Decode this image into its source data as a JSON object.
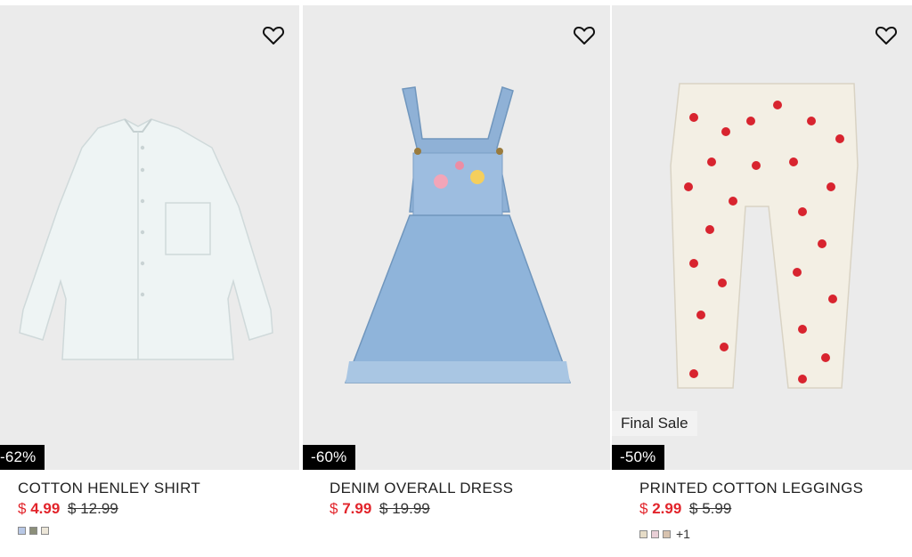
{
  "products": [
    {
      "name": "COTTON HENLEY SHIRT",
      "currency": "$",
      "sale_price": "4.99",
      "original_price": "$ 12.99",
      "discount": "-62%",
      "swatch_colors": [
        "#b8c8e6",
        "#8c8f7a",
        "#ece6d8"
      ],
      "more_colors": ""
    },
    {
      "name": "DENIM OVERALL DRESS",
      "currency": "$",
      "sale_price": "7.99",
      "original_price": "$ 19.99",
      "discount": "-60%",
      "swatch_colors": [],
      "more_colors": ""
    },
    {
      "name": "PRINTED COTTON LEGGINGS",
      "currency": "$",
      "sale_price": "2.99",
      "original_price": "$ 5.99",
      "discount": "-50%",
      "final_sale": "Final Sale",
      "swatch_colors": [
        "#e6dcc7",
        "#e9cfd6",
        "#d7c2ae"
      ],
      "more_colors": "+1"
    }
  ],
  "icons": {
    "favorite": "heart-outline-icon"
  },
  "colors": {
    "sale": "#e2242b",
    "image_bg": "#ebebeb",
    "badge": "#000000"
  }
}
